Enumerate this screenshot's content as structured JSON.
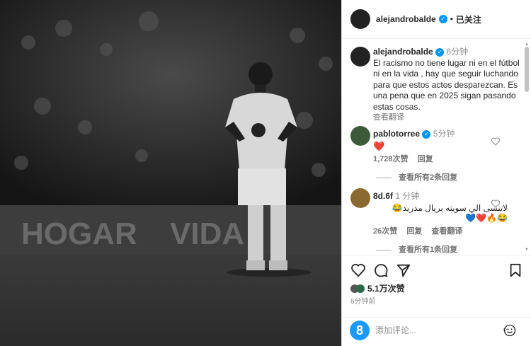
{
  "post": {
    "username": "alejandrobalde",
    "follow_status": "已关注",
    "caption_user": "alejandrobalde",
    "caption_time": "6分钟",
    "caption_text": "El racismo no tiene lugar ni en el fútbol ni en la vida , hay que seguir luchando para que estos actos desparezcan. Es una pena que en 2025 sigan pasando estas cosas.",
    "translate_label": "查看翻译"
  },
  "photo": {
    "banner_left": "HOGAR",
    "banner_right": "VIDA"
  },
  "comments": [
    {
      "user": "pablotorree",
      "time": "5分钟",
      "text": "❤️",
      "likes": "1,728次赞",
      "reply_label": "回复",
      "view_replies": "查看所有2条回复"
    },
    {
      "user": "8d.6f",
      "time": "1 分钟",
      "text": "لاتنسى الي سويته بريال مدريد😂",
      "text_line2": "💙❤️🔥😂",
      "likes": "26次赞",
      "reply_label": "回复",
      "translate_label": "查看翻译",
      "view_replies": "查看所有1条回复"
    }
  ],
  "actions": {
    "likes_count": "5.1万次赞",
    "time_ago": "6分钟前"
  },
  "add_comment": {
    "placeholder": "添加评论...",
    "avatar_letter": "8"
  },
  "colors": {
    "verified": "#0095f6",
    "heart_red": "#ed4956"
  }
}
